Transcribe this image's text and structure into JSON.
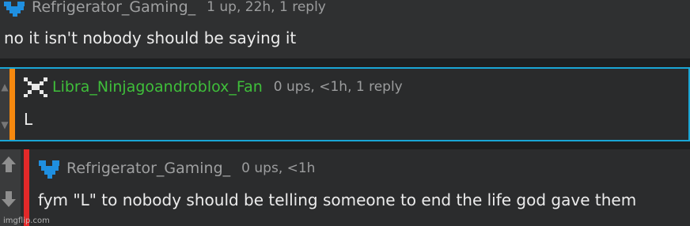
{
  "comments": [
    {
      "username": "Refrigerator_Gaming_",
      "meta": "1 up, 22h, 1 reply",
      "text": "no it isn't nobody should be saying it"
    },
    {
      "username": "Libra_Ninjagoandroblox_Fan",
      "meta": "0 ups, <1h, 1 reply",
      "text": "L"
    },
    {
      "username": "Refrigerator_Gaming_",
      "meta": "0 ups, <1h",
      "text": "fym \"L\" to nobody should be telling someone to end the life god gave them"
    }
  ],
  "watermark": "imgflip.com",
  "colors": {
    "username_default": "#9fa0a1",
    "username_green": "#3fbf3a",
    "reply_border": "#1aa6d6",
    "thread_orange": "#f7890f",
    "thread_red": "#e32929",
    "avatar_blue": "#1f8fe0"
  },
  "icons": {
    "vote_up": "up-arrow-icon",
    "vote_down": "down-arrow-icon"
  }
}
